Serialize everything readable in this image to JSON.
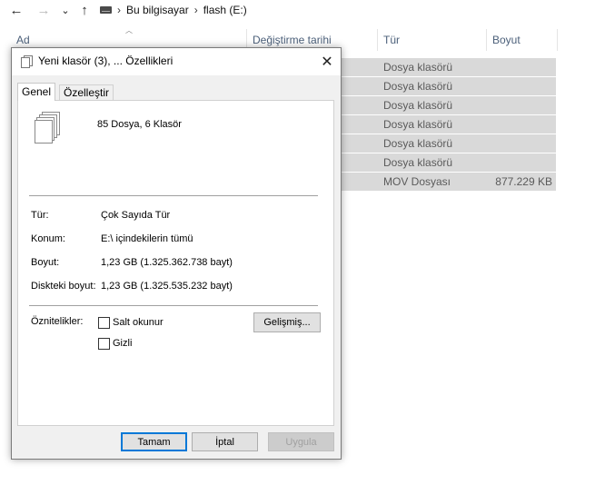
{
  "nav": {
    "back": "←",
    "forward": "→",
    "recent": "⌄",
    "up": "↑",
    "breadcrumbs": [
      "Bu bilgisayar",
      "flash (E:)"
    ],
    "separator": "›"
  },
  "columns": {
    "name": "Ad",
    "modified": "Değiştirme tarihi",
    "type": "Tür",
    "size": "Boyut"
  },
  "rows": [
    {
      "type": "Dosya klasörü",
      "size": ""
    },
    {
      "type": "Dosya klasörü",
      "size": ""
    },
    {
      "type": "Dosya klasörü",
      "size": ""
    },
    {
      "type": "Dosya klasörü",
      "size": ""
    },
    {
      "type": "Dosya klasörü",
      "size": ""
    },
    {
      "type": "Dosya klasörü",
      "size": ""
    },
    {
      "type": "MOV Dosyası",
      "size": "877.229 KB"
    }
  ],
  "dialog": {
    "title": "Yeni klasör (3), ... Özellikleri",
    "close": "✕",
    "tabs": [
      "Genel",
      "Özelleştir"
    ],
    "active_tab": "Genel",
    "summary": "85 Dosya, 6 Klasör",
    "props": {
      "type_label": "Tür:",
      "type_value": "Çok Sayıda Tür",
      "location_label": "Konum:",
      "location_value": "E:\\ içindekilerin tümü",
      "size_label": "Boyut:",
      "size_value": "1,23 GB (1.325.362.738 bayt)",
      "disk_label": "Diskteki boyut:",
      "disk_value": "1,23 GB (1.325.535.232 bayt)"
    },
    "attributes": {
      "label": "Öznitelikler:",
      "readonly": "Salt okunur",
      "hidden": "Gizli",
      "advanced": "Gelişmiş..."
    },
    "buttons": {
      "ok": "Tamam",
      "cancel": "İptal",
      "apply": "Uygula"
    }
  }
}
